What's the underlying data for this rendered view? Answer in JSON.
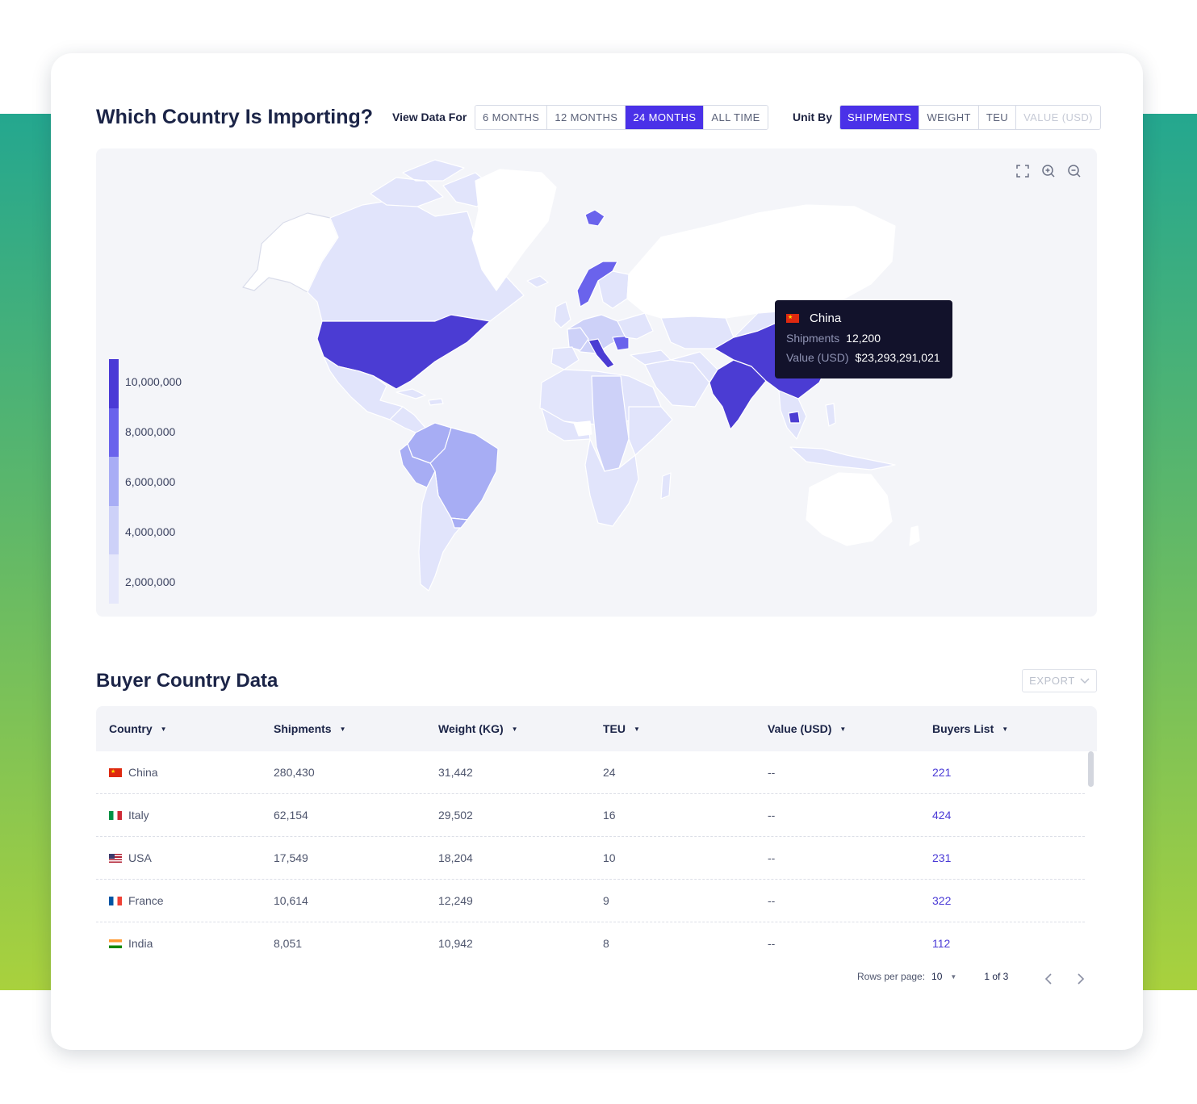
{
  "header": {
    "title": "Which Country Is Importing?",
    "view_label": "View Data For",
    "view_options": [
      "6 MONTHS",
      "12 MONTHS",
      "24 MONTHS",
      "ALL TIME"
    ],
    "view_selected": "24 MONTHS",
    "unit_label": "Unit By",
    "unit_options": [
      "SHIPMENTS",
      "WEIGHT",
      "TEU",
      "VALUE (USD)"
    ],
    "unit_selected": "SHIPMENTS",
    "unit_disabled": "VALUE (USD)"
  },
  "map": {
    "tools": [
      "fullscreen-icon",
      "zoom-in-icon",
      "zoom-out-icon"
    ],
    "legend": {
      "labels": [
        "10,000,000",
        "8,000,000",
        "6,000,000",
        "4,000,000",
        "2,000,000"
      ],
      "colors": [
        "#4a3ad6",
        "#6a63ec",
        "#a8adf5",
        "#cdd1f8",
        "#e6e8fb"
      ]
    },
    "tooltip": {
      "country": "China",
      "shipments_label": "Shipments",
      "shipments_value": "12,200",
      "value_label": "Value (USD)",
      "value_value": "$23,293,291,021"
    }
  },
  "table_section": {
    "title": "Buyer Country Data",
    "export_label": "EXPORT",
    "columns": [
      "Country",
      "Shipments",
      "Weight (KG)",
      "TEU",
      "Value (USD)",
      "Buyers List"
    ],
    "rows": [
      {
        "country": "China",
        "flag": "china-flag-icon",
        "shipments": "280,430",
        "weight": "31,442",
        "teu": "24",
        "value": "--",
        "buyers": "221"
      },
      {
        "country": "Italy",
        "flag": "italy-flag-icon",
        "shipments": "62,154",
        "weight": "29,502",
        "teu": "16",
        "value": "--",
        "buyers": "424"
      },
      {
        "country": "USA",
        "flag": "usa-flag-icon",
        "shipments": "17,549",
        "weight": "18,204",
        "teu": "10",
        "value": "--",
        "buyers": "231"
      },
      {
        "country": "France",
        "flag": "france-flag-icon",
        "shipments": "10,614",
        "weight": "12,249",
        "teu": "9",
        "value": "--",
        "buyers": "322"
      },
      {
        "country": "India",
        "flag": "india-flag-icon",
        "shipments": "8,051",
        "weight": "10,942",
        "teu": "8",
        "value": "--",
        "buyers": "112"
      }
    ]
  },
  "pagination": {
    "rows_label": "Rows per page:",
    "rows_value": "10",
    "page_text": "1 of 3"
  },
  "colors": {
    "accent": "#4a31e8",
    "link": "#4a3ad6",
    "tooltip_bg": "#12122b"
  }
}
